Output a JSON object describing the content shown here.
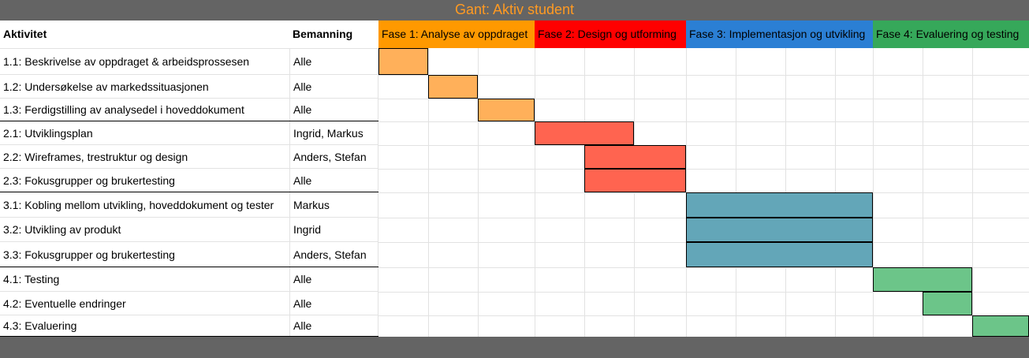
{
  "title": "Gant: Aktiv student",
  "colors": {
    "title": "#ff9a22",
    "frame": "#646464",
    "phase1": "#ff9900",
    "phase2": "#ff0000",
    "phase3": "#2b7fd4",
    "phase4": "#36a85a",
    "bar1": "#ffb05a",
    "bar2": "#ff6450",
    "bar3": "#63a6b8",
    "bar4": "#6cc589"
  },
  "header": {
    "activity": "Aktivitet",
    "staffing": "Bemanning",
    "phases": [
      {
        "label": "Fase 1: Analyse av oppdraget",
        "color": "#ff9900"
      },
      {
        "label": "Fase 2: Design og utforming",
        "color": "#ff0000"
      },
      {
        "label": "Fase 3: Implementasjon og utvikling",
        "color": "#2b7fd4"
      },
      {
        "label": "Fase 4: Evaluering og testing",
        "color": "#36a85a"
      }
    ]
  },
  "rows": [
    {
      "activity": "1.1: Beskrivelse av oppdraget & arbeidsprossesen",
      "staffing": "Alle",
      "start": 0,
      "span": 1,
      "phase": 1
    },
    {
      "activity": "1.2: Undersøkelse av markedssituasjonen",
      "staffing": "Alle",
      "start": 1,
      "span": 1,
      "phase": 1
    },
    {
      "activity": "1.3: Ferdigstilling av analysedel i hoveddokument",
      "staffing": "Alle",
      "start": 2,
      "span": 1,
      "phase": 1
    },
    {
      "activity": "2.1: Utviklingsplan",
      "staffing": "Ingrid, Markus",
      "start": 3,
      "span": 2,
      "phase": 2
    },
    {
      "activity": "2.2: Wireframes, trestruktur og design",
      "staffing": "Anders, Stefan",
      "start": 4,
      "span": 2,
      "phase": 2
    },
    {
      "activity": "2.3: Fokusgrupper og brukertesting",
      "staffing": "Alle",
      "start": 4,
      "span": 2,
      "phase": 2
    },
    {
      "activity": "3.1: Kobling mellom utvikling, hoveddokument og tester",
      "staffing": "Markus",
      "start": 6,
      "span": 4,
      "phase": 3
    },
    {
      "activity": "3.2: Utvikling av produkt",
      "staffing": "Ingrid",
      "start": 6,
      "span": 4,
      "phase": 3
    },
    {
      "activity": "3.3: Fokusgrupper og brukertesting",
      "staffing": "Anders, Stefan",
      "start": 6,
      "span": 4,
      "phase": 3
    },
    {
      "activity": "4.1: Testing",
      "staffing": "Alle",
      "start": 10,
      "span": 2,
      "phase": 4
    },
    {
      "activity": "4.2: Eventuelle endringer",
      "staffing": "Alle",
      "start": 11,
      "span": 1,
      "phase": 4
    },
    {
      "activity": "4.3: Evaluering",
      "staffing": "Alle",
      "start": 12,
      "span": 1,
      "phase": 4
    }
  ]
}
